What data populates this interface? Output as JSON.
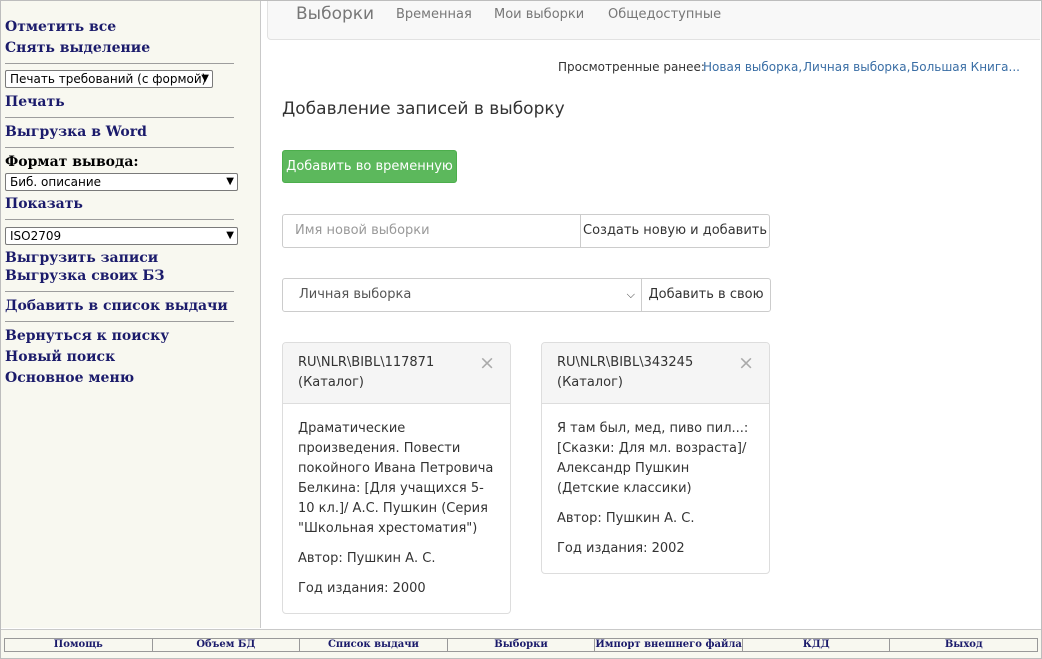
{
  "sidebar": {
    "mark_all": "Отметить все",
    "unmark": "Снять выделение",
    "print_select": "Печать требований (с формой)",
    "print": "Печать",
    "export_word": "Выгрузка в Word",
    "format_label": "Формат вывода:",
    "format_select": "Биб. описание",
    "show": "Показать",
    "export_format_select": "ISO2709",
    "export_records": "Выгрузить записи",
    "export_own_db": "Выгрузка своих БЗ",
    "add_to_issue_list": "Добавить в список выдачи",
    "back_to_search": "Вернуться к поиску",
    "new_search": "Новый поиск",
    "main_menu": "Основное меню"
  },
  "navbar": {
    "brand": "Выборки",
    "tabs": [
      "Временная",
      "Мои выборки",
      "Общедоступные"
    ]
  },
  "recent": {
    "label": "Просмотренные ранее:",
    "links": [
      "Новая выборка,",
      "Личная выборка,",
      "Большая Книга..."
    ]
  },
  "main": {
    "title": "Добавление записей в выборку",
    "add_temp_button": "Добавить во временную",
    "new_name_placeholder": "Имя новой выборки",
    "create_add_button": "Создать новую и добавить",
    "selection_value": "Личная выборка",
    "add_own_button": "Добавить в свою"
  },
  "cards": [
    {
      "id": "RU\\NLR\\BIBL\\117871 (Каталог)",
      "title": "Драматические произведения. Повести покойного Ивана Петровича Белкина: [Для учащихся 5-10 кл.]/ А.С. Пушкин (Серия \"Школьная хрестоматия\")",
      "author": "Автор: Пушкин А. С.",
      "year": "Год издания: 2000"
    },
    {
      "id": "RU\\NLR\\BIBL\\343245 (Каталог)",
      "title": "Я там был, мед, пиво пил...: [Сказки: Для мл. возраста]/ Александр Пушкин (Детские классики)",
      "author": "Автор: Пушкин А. С.",
      "year": "Год издания: 2002"
    }
  ],
  "close_glyph": "×",
  "footer": [
    "Помощь",
    "Объем БД",
    "Список выдачи",
    "Выборки",
    "Импорт внешнего файла",
    "КДД",
    "Выход"
  ],
  "colors": {
    "accent_green": "#5cb85c",
    "link_blue": "#1b1b6b"
  }
}
